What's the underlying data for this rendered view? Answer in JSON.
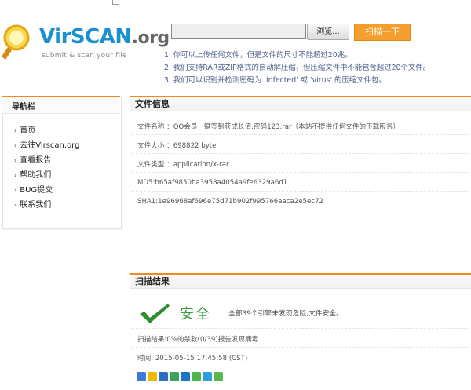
{
  "brand": {
    "name_main": "VirSCAN",
    "name_suffix": ".org",
    "tagline": "submit & scan your file"
  },
  "upload": {
    "file_value": "",
    "browse_label": "浏览...",
    "scan_label": "扫描一下",
    "rules": [
      "1. 你可以上传任何文件，但是文件的尺寸不能超过20兆。",
      "2. 我们支持RAR或ZIP格式的自动解压缩，但压缩文件中不能包含超过20个文件。",
      "3. 我们可以识别并检测密码为 'infected' 或 'virus' 的压缩文件包。"
    ]
  },
  "sidebar": {
    "title": "导航栏",
    "items": [
      {
        "label": "首页"
      },
      {
        "label": "去往Virscan.org"
      },
      {
        "label": "查看报告"
      },
      {
        "label": "帮助我们"
      },
      {
        "label": "BUG提交"
      },
      {
        "label": "联系我们"
      }
    ]
  },
  "file_info": {
    "title": "文件信息",
    "name_row": "文件名称 ：QQ会员一键签到获成长值,密码123.rar（本站不提供任何文件的下载服务）",
    "size_row": "文件大小 ：698822 byte",
    "type_row": "文件类型 ：application/x-rar",
    "md5_row": "MD5:b65af9850ba3958a4054a9fe6329a6d1",
    "sha1_row": "SHA1:1e96968af696e75d71b902f995766aaca2e5ec72"
  },
  "scan_result": {
    "title": "扫描结果",
    "status": "安全",
    "status_desc": "全部39个引擎未发现危险,文件安全。",
    "summary": "扫描结果:0%的杀软(0/39)报告发现病毒",
    "time": "时间: 2015-05-15 17:45:58 (CST)"
  },
  "colors": {
    "accent_orange": "#f08a1f",
    "scan_button": "#f59e2e",
    "safe_green": "#3b9b3b",
    "brand_blue": "#1a8fd1"
  },
  "share_icons": [
    "add-share-icon",
    "qzone-icon",
    "renren-icon",
    "douban-icon",
    "kaixin-icon",
    "wechat-icon",
    "weibo-icon",
    "tencent-icon"
  ]
}
